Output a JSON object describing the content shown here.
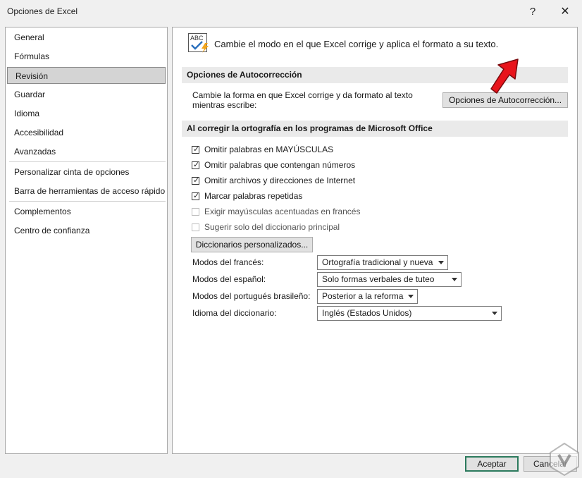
{
  "window": {
    "title": "Opciones de Excel",
    "help_glyph": "?",
    "close_glyph": "✕"
  },
  "sidebar": {
    "items": [
      {
        "label": "General"
      },
      {
        "label": "Fórmulas"
      },
      {
        "label": "Revisión",
        "selected": true
      },
      {
        "label": "Guardar"
      },
      {
        "label": "Idioma"
      },
      {
        "label": "Accesibilidad"
      },
      {
        "label": "Avanzadas"
      },
      {
        "label": "Personalizar cinta de opciones"
      },
      {
        "label": "Barra de herramientas de acceso rápido"
      },
      {
        "label": "Complementos"
      },
      {
        "label": "Centro de confianza"
      }
    ]
  },
  "main": {
    "header_icon": "abc-spellcheck-icon",
    "header_icon_text": "ABC",
    "header": "Cambie el modo en el que Excel corrige y aplica el formato a su texto.",
    "autocorrect_section": "Opciones de Autocorrección",
    "autocorrect_desc_line1": "Cambie la forma en que Excel corrige y da formato al texto",
    "autocorrect_desc_line2": "mientras escribe:",
    "autocorrect_button": "Opciones de Autocorrección...",
    "spelling_section": "Al corregir la ortografía en los programas de Microsoft Office",
    "checkboxes": [
      {
        "label": "Omitir palabras en MAYÚSCULAS",
        "checked": true,
        "enabled": true
      },
      {
        "label": "Omitir palabras que contengan números",
        "checked": true,
        "enabled": true
      },
      {
        "label": "Omitir archivos y direcciones de Internet",
        "checked": true,
        "enabled": true
      },
      {
        "label": "Marcar palabras repetidas",
        "checked": true,
        "enabled": true
      },
      {
        "label": "Exigir mayúsculas acentuadas en francés",
        "checked": false,
        "enabled": false
      },
      {
        "label": "Sugerir solo del diccionario principal",
        "checked": false,
        "enabled": false
      }
    ],
    "dictionaries_button": "Diccionarios personalizados...",
    "fields": [
      {
        "label": "Modos del francés:",
        "value": "Ortografía tradicional y nueva"
      },
      {
        "label": "Modos del español:",
        "value": "Solo formas verbales de tuteo"
      },
      {
        "label": "Modos del portugués brasileño:",
        "value": "Posterior a la reforma"
      },
      {
        "label": "Idioma del diccionario:",
        "value": "Inglés (Estados Unidos)"
      }
    ]
  },
  "footer": {
    "accept": "Aceptar",
    "cancel": "Cancelar"
  },
  "colors": {
    "arrow": "#e8141b",
    "accept_border": "#2c7a5d",
    "selection": "#d4d4d4"
  }
}
